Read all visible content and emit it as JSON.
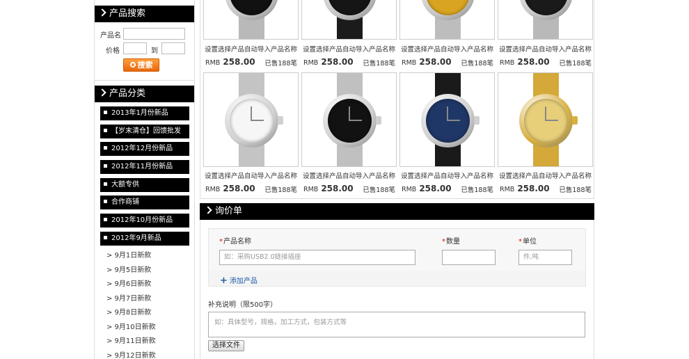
{
  "search": {
    "title": "产品搜索",
    "name_label": "产品名",
    "name_value": "",
    "price_label": "价格",
    "to_label": "到",
    "price_min": "",
    "price_max": "",
    "button_label": "搜索"
  },
  "category": {
    "title": "产品分类",
    "items": [
      {
        "label": "2013年1月份新品"
      },
      {
        "label": "【岁末清仓】回馈批发"
      },
      {
        "label": "2012年12月份新品"
      },
      {
        "label": "2012年11月份新品"
      },
      {
        "label": "大额专供"
      },
      {
        "label": "合作商铺"
      },
      {
        "label": "2012年10月份新品"
      },
      {
        "label": "2012年9月新品"
      }
    ],
    "subitems": [
      {
        "label": "> 9月1日新款"
      },
      {
        "label": "> 9月5日新款"
      },
      {
        "label": "> 9月6日新款"
      },
      {
        "label": "> 9月7日新款"
      },
      {
        "label": "> 9月8日新款"
      },
      {
        "label": "> 9月10日新款"
      },
      {
        "label": "> 9月11日新款"
      },
      {
        "label": "> 9月12日新款"
      }
    ]
  },
  "products": [
    {
      "name": "设置选择产品自动导入产品名称",
      "currency": "RMB",
      "price": "258.00",
      "sold": "已售188笔",
      "case": "#c9c9c9",
      "dial": "#111111",
      "band": "#b9b9b9"
    },
    {
      "name": "设置选择产品自动导入产品名称",
      "currency": "RMB",
      "price": "258.00",
      "sold": "已售188笔",
      "case": "#c9c9c9",
      "dial": "#151515",
      "band": "#1b1b1b"
    },
    {
      "name": "设置选择产品自动导入产品名称",
      "currency": "RMB",
      "price": "258.00",
      "sold": "已售188笔",
      "case": "#c9c9c9",
      "dial": "#d9a520",
      "band": "#bdbdbd"
    },
    {
      "name": "设置选择产品自动导入产品名称",
      "currency": "RMB",
      "price": "258.00",
      "sold": "已售188笔",
      "case": "#c9c9c9",
      "dial": "#1a1a1a",
      "band": "#b9b9b9"
    },
    {
      "name": "设置选择产品自动导入产品名称",
      "currency": "RMB",
      "price": "258.00",
      "sold": "已售188笔",
      "case": "#d0d0d0",
      "dial": "#f6f6f6",
      "band": "#c4c4c4"
    },
    {
      "name": "设置选择产品自动导入产品名称",
      "currency": "RMB",
      "price": "258.00",
      "sold": "已售188笔",
      "case": "#cfcfcf",
      "dial": "#121212",
      "band": "#c0c0c0"
    },
    {
      "name": "设置选择产品自动导入产品名称",
      "currency": "RMB",
      "price": "258.00",
      "sold": "已售188笔",
      "case": "#cfcfcf",
      "dial": "#1f3766",
      "band": "#1a1a1a"
    },
    {
      "name": "设置选择产品自动导入产品名称",
      "currency": "RMB",
      "price": "258.00",
      "sold": "已售188笔",
      "case": "#d8b040",
      "dial": "#e7cf7a",
      "band": "#d4a93a"
    }
  ],
  "inquiry": {
    "title": "询价单",
    "product_name_label": "产品名称",
    "product_name_placeholder": "如：采购USB2.0链接插座",
    "quantity_label": "数量",
    "quantity_value": "",
    "unit_label": "单位",
    "unit_placeholder": "件,吨",
    "add_product_label": "添加产品",
    "note_label": "补充说明（限500字）",
    "note_placeholder": "如：具体型号，规格，加工方式，包装方式等",
    "file_button_label": "选择文件",
    "required_mark": "*"
  }
}
